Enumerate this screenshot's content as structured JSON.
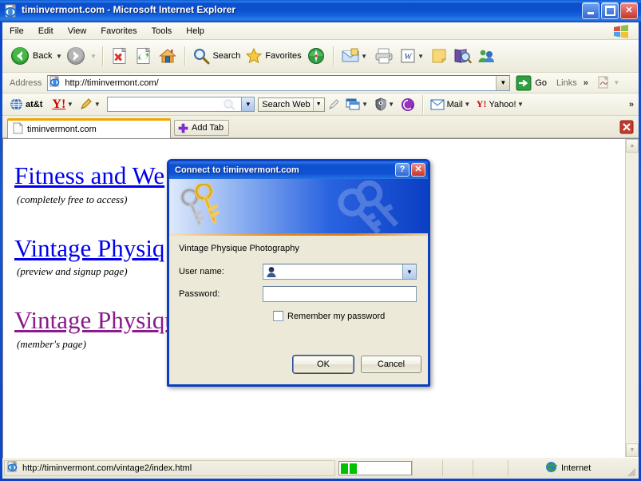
{
  "window": {
    "title": "timinvermont.com - Microsoft Internet Explorer",
    "icon": "ie-document-icon",
    "buttons": {
      "minimize": "minimize-button",
      "maximize": "maximize-restore-button",
      "close": "close-button"
    }
  },
  "menubar": {
    "items": [
      {
        "label": "File"
      },
      {
        "label": "Edit"
      },
      {
        "label": "View"
      },
      {
        "label": "Favorites"
      },
      {
        "label": "Tools"
      },
      {
        "label": "Help"
      }
    ],
    "windows_flag": "windows-logo-icon"
  },
  "toolbar": {
    "back_label": "Back",
    "forward_label": "",
    "stop_icon": "stop-icon",
    "refresh_icon": "refresh-icon",
    "home_icon": "home-icon",
    "search_label": "Search",
    "favorites_label": "Favorites",
    "history_icon": "history-icon",
    "mail_icon": "mail-icon",
    "print_icon": "print-icon",
    "edit_word_icon": "edit-in-word-icon",
    "notes_icon": "notes-icon",
    "research_icon": "research-icon",
    "messenger_icon": "messenger-icon"
  },
  "address": {
    "label": "Address",
    "value": "http://timinvermont.com/",
    "placeholder": "",
    "favicon": "page-icon",
    "go_label": "Go",
    "links_label": "Links",
    "links_chevron": "»"
  },
  "yahoo_toolbar": {
    "att_label": "at&t",
    "yahoo_logo": "Y!",
    "pencil_icon": "pencil-icon",
    "search_value": "",
    "search_placeholder": "",
    "search_web_label": "Search Web",
    "highlighter_icon": "highlighter-icon",
    "popup_blocker_icon": "popup-blocker-icon",
    "antispy_icon": "anti-spy-icon",
    "purple_icon": "yahoo-circle-icon",
    "mail_label": "Mail",
    "yahoo_label": "Yahoo!",
    "overflow_chevron": "»"
  },
  "tabbar": {
    "tabs": [
      {
        "label": "timinvermont.com",
        "icon": "page-icon",
        "active": true
      }
    ],
    "add_tab_label": "Add Tab",
    "close_tab_icon": "close-tab-icon"
  },
  "page": {
    "links": [
      {
        "title": "Fitness and We",
        "subtitle": "(completely free to access)",
        "state": "unvisited",
        "color": "#0000ee"
      },
      {
        "title": "Vintage Physiq",
        "subtitle": "(preview and signup page)",
        "state": "unvisited",
        "color": "#0000ee"
      },
      {
        "title": "Vintage Physique Photography",
        "subtitle": "(member's page)",
        "state": "visited",
        "color": "#8b1a8b"
      }
    ]
  },
  "dialog": {
    "title": "Connect to timinvermont.com",
    "help_label": "?",
    "close_label": "✕",
    "keys_icon": "keys-icon",
    "realm": "Vintage Physique Photography",
    "username_label": "User name:",
    "username_value": "",
    "username_icon": "user-icon",
    "password_label": "Password:",
    "password_value": "",
    "remember_label": "Remember my password",
    "remember_checked": false,
    "ok_label": "OK",
    "cancel_label": "Cancel"
  },
  "statusbar": {
    "url": "http://timinvermont.com/vintage2/index.html",
    "url_icon": "ie-icon",
    "progress_blocks": 2,
    "zone_label": "Internet",
    "zone_icon": "globe-icon"
  },
  "colors": {
    "titlebar_blue": "#0d50cf",
    "dialog_border": "#0a40c0",
    "chrome_beige": "#ece9d8",
    "link_unvisited": "#0000ee",
    "link_visited": "#8b1a8b",
    "tab_accent": "#f0a500",
    "progress_green": "#00c000"
  }
}
